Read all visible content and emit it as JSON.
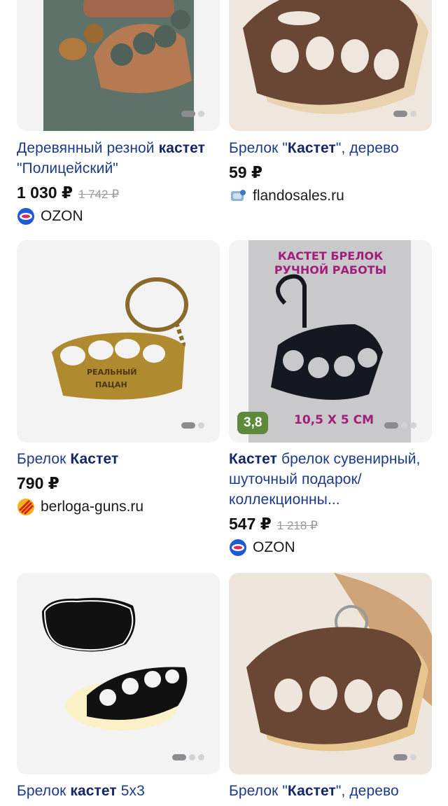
{
  "products": [
    {
      "title_parts": [
        {
          "text": "Деревянный резной ",
          "bold": false
        },
        {
          "text": "кастет",
          "bold": true
        },
        {
          "text": " \"Полицейский\"",
          "bold": false
        }
      ],
      "price": "1 030 ₽",
      "old_price": "1 742 ₽",
      "shop": "OZON",
      "shop_logo": "ozon-logo"
    },
    {
      "title_parts": [
        {
          "text": "Брелок \"",
          "bold": false
        },
        {
          "text": "Кастет",
          "bold": true
        },
        {
          "text": "\", дерево",
          "bold": false
        }
      ],
      "price": "59 ₽",
      "old_price": "",
      "shop": "flandosales.ru",
      "shop_logo": "flandosales-logo"
    },
    {
      "title_parts": [
        {
          "text": "Брелок ",
          "bold": false
        },
        {
          "text": "Кастет",
          "bold": true
        }
      ],
      "price": "790 ₽",
      "old_price": "",
      "shop": "berloga-guns.ru",
      "shop_logo": "berloga-logo",
      "image_text": [
        "РЕАЛЬНЫЙ",
        "ПАЦАН"
      ]
    },
    {
      "title_parts": [
        {
          "text": "Кастет",
          "bold": true
        },
        {
          "text": " брелок сувенирный, шуточный подарок/коллекционны...",
          "bold": false
        }
      ],
      "price": "547 ₽",
      "old_price": "1 218 ₽",
      "shop": "OZON",
      "shop_logo": "ozon-logo",
      "rating": "3,8",
      "image_text": [
        "КАСТЕТ БРЕЛОК",
        "РУЧНОЙ РАБОТЫ",
        "10,5 X 5 СМ"
      ]
    },
    {
      "title_parts": [
        {
          "text": "Брелок ",
          "bold": false
        },
        {
          "text": "кастет",
          "bold": true
        },
        {
          "text": " 5х3",
          "bold": false
        }
      ]
    },
    {
      "title_parts": [
        {
          "text": "Брелок \"",
          "bold": false
        },
        {
          "text": "Кастет",
          "bold": true
        },
        {
          "text": "\", дерево",
          "bold": false
        }
      ]
    }
  ],
  "colors": {
    "ozon": "#e0245e",
    "rating_bg": "#5c8a3a",
    "link": "#1c3a8a"
  }
}
